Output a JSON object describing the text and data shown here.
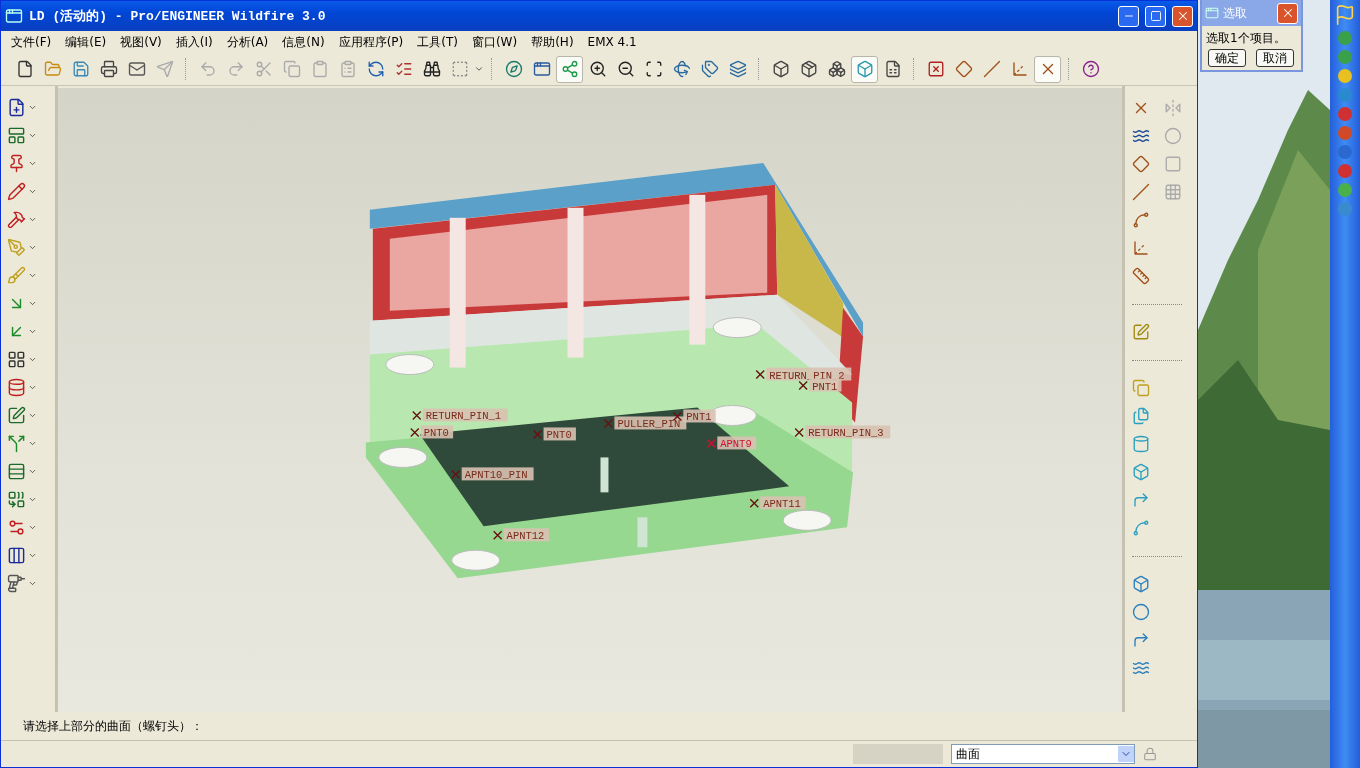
{
  "window": {
    "title": "LD (活动的) - Pro/ENGINEER Wildfire 3.0"
  },
  "menu": [
    "文件(F)",
    "编辑(E)",
    "视图(V)",
    "插入(I)",
    "分析(A)",
    "信息(N)",
    "应用程序(P)",
    "工具(T)",
    "窗口(W)",
    "帮助(H)",
    "EMX 4.1"
  ],
  "toolbar": {
    "groups": [
      [
        {
          "selected": false
        },
        {
          "selected": false
        },
        {
          "selected": false
        },
        {
          "selected": false
        },
        {
          "selected": false
        },
        {
          "selected": false
        }
      ],
      [
        {
          "selected": false
        },
        {
          "selected": false
        },
        {
          "selected": false
        },
        {
          "selected": false
        },
        {
          "selected": false
        },
        {
          "selected": false
        },
        {
          "selected": false
        },
        {
          "selected": false
        },
        {
          "selected": false
        },
        {
          "selected": false
        }
      ],
      [
        {
          "selected": false
        },
        {
          "selected": false
        },
        {
          "selected": true
        },
        {
          "selected": false
        },
        {
          "selected": false
        },
        {
          "selected": false
        },
        {
          "selected": false
        },
        {
          "selected": false
        },
        {
          "selected": false
        }
      ],
      [
        {
          "selected": false
        },
        {
          "selected": false
        },
        {
          "selected": false
        },
        {
          "selected": true
        },
        {
          "selected": false
        }
      ],
      [
        {
          "selected": false
        },
        {
          "selected": false
        },
        {
          "selected": false
        },
        {
          "selected": false
        },
        {
          "selected": true
        }
      ],
      [
        {
          "selected": false
        }
      ]
    ]
  },
  "model": {
    "points": [
      {
        "label": "RETURN_PIN_2",
        "selected": false
      },
      {
        "label": "PNT1",
        "selected": false
      },
      {
        "label": "RETURN_PIN_1",
        "selected": false
      },
      {
        "label": "PNT0",
        "selected": false
      },
      {
        "label": "PNT0",
        "selected": false
      },
      {
        "label": "PULLER_PIN",
        "selected": false
      },
      {
        "label": "PNT1",
        "selected": false
      },
      {
        "label": "APNT9",
        "selected": true
      },
      {
        "label": "RETURN_PIN_3",
        "selected": false
      },
      {
        "label": "APNT10_PIN",
        "selected": false
      },
      {
        "label": "APNT11",
        "selected": false
      },
      {
        "label": "APNT12",
        "selected": false
      }
    ]
  },
  "message": "请选择上部分的曲面（螺钉头）：",
  "status_bar": {
    "filter": "曲面"
  },
  "select_dialog": {
    "title": "选取",
    "message": "选取1个项目。",
    "buttons": [
      "确定",
      "取消"
    ]
  }
}
